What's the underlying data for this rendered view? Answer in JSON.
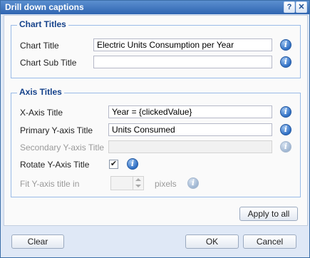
{
  "window": {
    "title": "Drill down captions",
    "help_glyph": "?",
    "close_glyph": "✕"
  },
  "chart_titles": {
    "legend": "Chart Titles",
    "chart_title": {
      "label": "Chart Title",
      "value": "Electric Units Consumption per Year"
    },
    "chart_sub_title": {
      "label": "Chart Sub Title",
      "value": ""
    }
  },
  "axis_titles": {
    "legend": "Axis Titles",
    "x_axis_title": {
      "label": "X-Axis Title",
      "value": "Year = {clickedValue}"
    },
    "primary_y_axis_title": {
      "label": "Primary Y-axis Title",
      "value": "Units Consumed"
    },
    "secondary_y_axis_title": {
      "label": "Secondary Y-axis Title",
      "value": "",
      "disabled": true
    },
    "rotate_y_axis_title": {
      "label": "Rotate Y-Axis Title",
      "checked": true
    },
    "fit_y_axis_title": {
      "label": "Fit Y-axis title in",
      "value": "",
      "unit": "pixels",
      "disabled": true
    }
  },
  "buttons": {
    "apply_to_all": "Apply to all",
    "clear": "Clear",
    "ok": "OK",
    "cancel": "Cancel"
  },
  "icons": {
    "info": "info-icon",
    "checkmark": "✔"
  },
  "colors": {
    "titlebar": "#2f65b1",
    "legend_text": "#15428b",
    "window_bg": "#dfe8f6"
  }
}
